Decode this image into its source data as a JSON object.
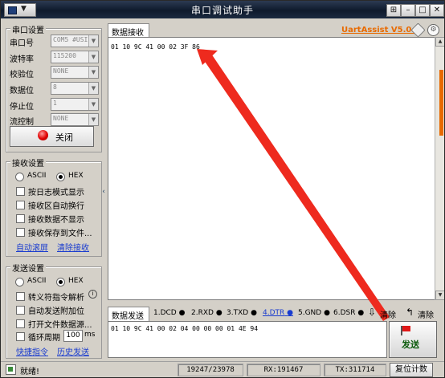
{
  "window": {
    "title": "串口调试助手"
  },
  "titlebar": {
    "pin": "⊞",
    "minimize": "–",
    "maximize": "□",
    "close": "✕"
  },
  "serial": {
    "legend": "串口设置",
    "rows": [
      {
        "label": "串口号",
        "value": "COM5 #USI"
      },
      {
        "label": "波特率",
        "value": "115200"
      },
      {
        "label": "校验位",
        "value": "NONE"
      },
      {
        "label": "数据位",
        "value": "8"
      },
      {
        "label": "停止位",
        "value": "1"
      },
      {
        "label": "流控制",
        "value": "NONE"
      }
    ],
    "close_button": "关闭"
  },
  "receive_settings": {
    "legend": "接收设置",
    "ascii": "ASCII",
    "hex": "HEX",
    "options": [
      "按日志模式显示",
      "接收区自动换行",
      "接收数据不显示",
      "接收保存到文件..."
    ],
    "links": [
      "自动滚屏",
      "清除接收"
    ]
  },
  "send_settings": {
    "legend": "发送设置",
    "ascii": "ASCII",
    "hex": "HEX",
    "options": [
      "转义符指令解析",
      "自动发送附加位",
      "打开文件数据源..."
    ],
    "cycle_label": "循环周期",
    "cycle_value": "100",
    "cycle_unit": "ms",
    "links": [
      "快捷指令",
      "历史发送"
    ]
  },
  "brand": "UartAssist V5.0.2",
  "receive": {
    "tab": "数据接收",
    "content": "01 10 9C 41 00 02 3F 86"
  },
  "send": {
    "tab": "数据发送",
    "signals": [
      "1.DCD",
      "2.RXD",
      "3.TXD",
      "4.DTR",
      "5.GND",
      "6.DSR"
    ],
    "clear1": "清除",
    "clear2": "清除",
    "content": "01 10 9C 41 00 02 04 00 00 00 01 4E 94",
    "send_button": "发送"
  },
  "status": {
    "ready": "就绪!",
    "counter": "19247/23978",
    "rx": "RX:191467",
    "tx": "TX:311714",
    "reset": "复位计数"
  },
  "colors": {
    "brand": "#e86a00",
    "arrow": "#ee2a1e",
    "link": "#1a3ccf"
  }
}
